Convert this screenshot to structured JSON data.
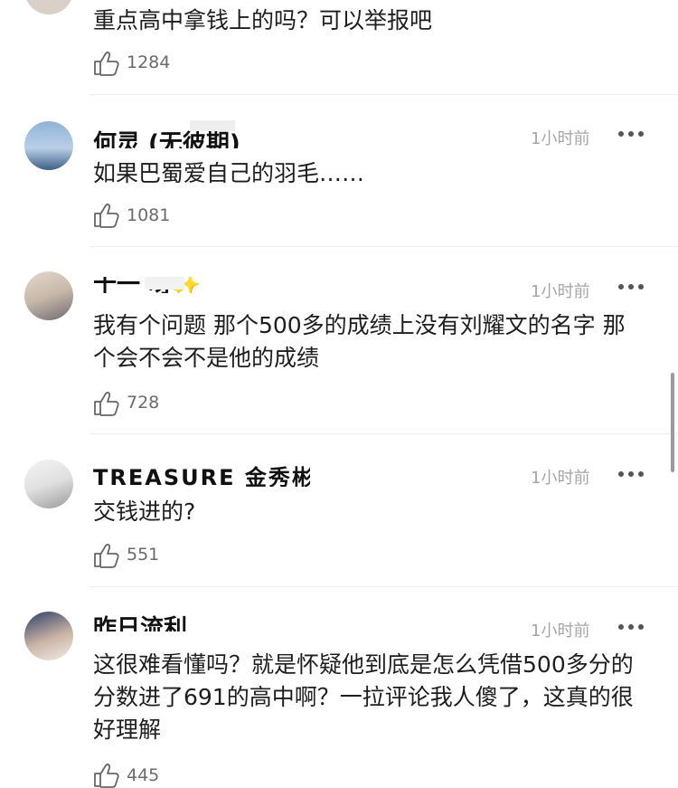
{
  "comments": [
    {
      "name": "",
      "time": "",
      "text": "重点高中拿钱上的吗？可以举报吧",
      "likes": "1284"
    },
    {
      "name": "何灵 (无彼期)",
      "time": "1小时前",
      "text": "如果巴蜀爱自己的羽毛……",
      "likes": "1081"
    },
    {
      "name": "十一 呀✨",
      "time": "1小时前",
      "text": "我有个问题 那个500多的成绩上没有刘耀文的名字 那个会不会不是他的成绩",
      "likes": "728"
    },
    {
      "name": "TREASURE 金秀彬",
      "time": "1小时前",
      "text": "交钱进的?",
      "likes": "551"
    },
    {
      "name": "昨日流利",
      "time": "1小时前",
      "text": "这很难看懂吗？就是怀疑他到底是怎么凭借500多分的分数进了691的高中啊？一拉评论我人傻了，这真的很好理解",
      "likes": "445"
    }
  ],
  "colors": {
    "text": "#1e1e1e",
    "time": "#a6a6a6",
    "like": "#6b6b6b",
    "divider": "#ececec"
  },
  "icons": [
    "thumbs-up-icon",
    "more-dots-icon"
  ]
}
